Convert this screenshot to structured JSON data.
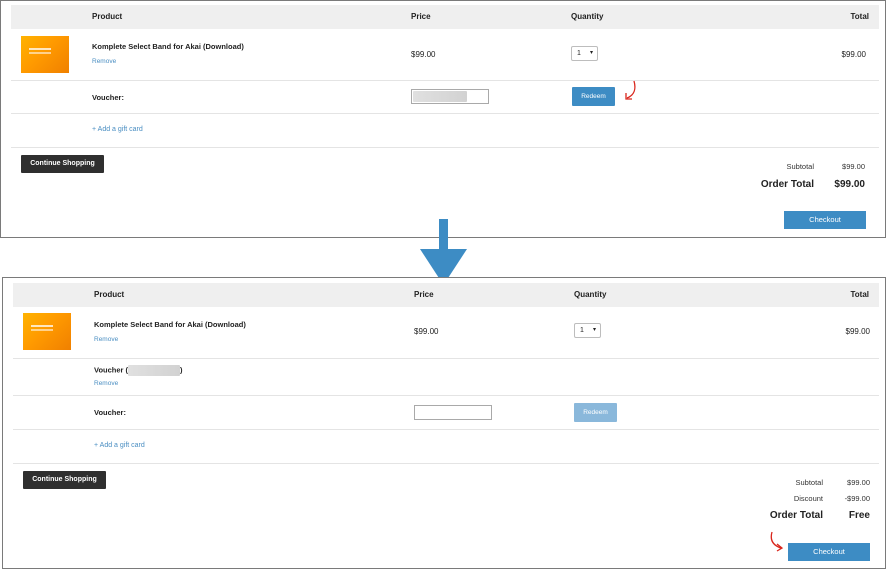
{
  "colors": {
    "accent": "#3d8cc4",
    "dark_button": "#2f2f2f",
    "link": "#4a8ec2",
    "annotation": "#d9261c"
  },
  "icons": {
    "transition_arrow": "down-arrow-icon",
    "annotation_arrow": "curved-red-arrow-icon",
    "select_chevron": "chevron-down-icon"
  },
  "before": {
    "headers": {
      "product": "Product",
      "price": "Price",
      "quantity": "Quantity",
      "total": "Total"
    },
    "item": {
      "name": "Komplete Select Band for Akai (Download)",
      "remove": "Remove",
      "price": "$99.00",
      "quantity": "1",
      "total": "$99.00"
    },
    "voucher_label": "Voucher:",
    "redeem_label": "Redeem",
    "add_gift_card": "+ Add a gift card",
    "continue_label": "Continue Shopping",
    "subtotal_label": "Subtotal",
    "subtotal_value": "$99.00",
    "order_total_label": "Order Total",
    "order_total_value": "$99.00",
    "checkout_label": "Checkout"
  },
  "after": {
    "headers": {
      "product": "Product",
      "price": "Price",
      "quantity": "Quantity",
      "total": "Total"
    },
    "item": {
      "name": "Komplete Select Band for Akai (Download)",
      "remove": "Remove",
      "price": "$99.00",
      "quantity": "1",
      "total": "$99.00"
    },
    "applied_voucher_prefix": "Voucher (",
    "applied_voucher_suffix": ")",
    "applied_voucher_remove": "Remove",
    "voucher_label": "Voucher:",
    "redeem_label": "Redeem",
    "add_gift_card": "+ Add a gift card",
    "continue_label": "Continue Shopping",
    "subtotal_label": "Subtotal",
    "subtotal_value": "$99.00",
    "discount_label": "Discount",
    "discount_value": "-$99.00",
    "order_total_label": "Order Total",
    "order_total_value": "Free",
    "checkout_label": "Checkout"
  }
}
